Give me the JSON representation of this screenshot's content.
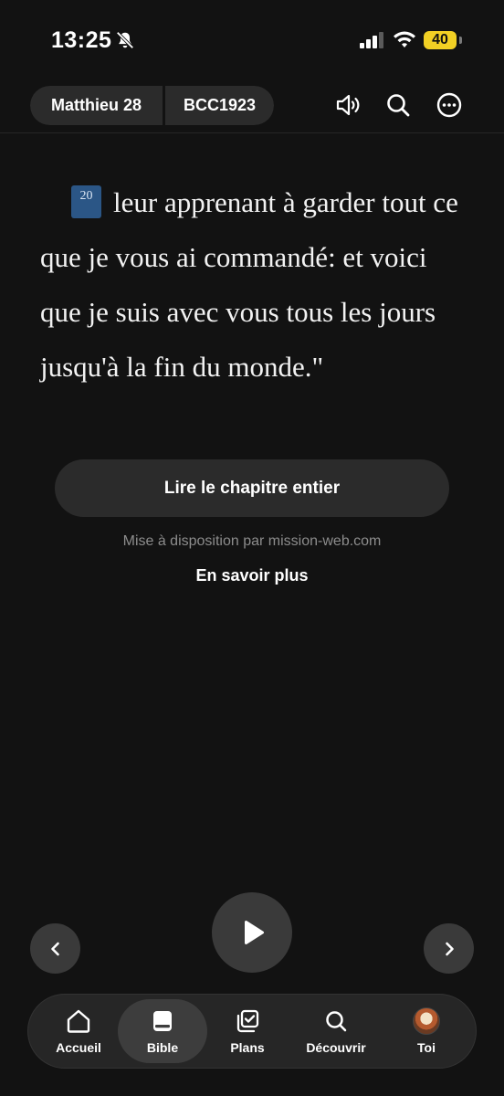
{
  "status_bar": {
    "time": "13:25",
    "battery": "40"
  },
  "header": {
    "book": "Matthieu 28",
    "version": "BCC1923"
  },
  "verse": {
    "number": "20",
    "text": "leur apprenant à garder tout ce que je vous ai commandé: et voici que je suis avec vous tous les jours jusqu'à la fin du monde.\""
  },
  "actions": {
    "read_chapter": "Lire le chapitre entier",
    "provided_by": "Mise à disposition par mission-web.com",
    "learn_more": "En savoir plus"
  },
  "tabs": [
    {
      "label": "Accueil",
      "icon": "home-icon"
    },
    {
      "label": "Bible",
      "icon": "bible-icon",
      "active": true
    },
    {
      "label": "Plans",
      "icon": "plans-icon"
    },
    {
      "label": "Découvrir",
      "icon": "search-icon"
    },
    {
      "label": "Toi",
      "icon": "avatar"
    }
  ],
  "colors": {
    "background": "#121212",
    "surface": "#2b2b2b",
    "verse_badge": "#2b5686",
    "battery": "#f2d024"
  }
}
